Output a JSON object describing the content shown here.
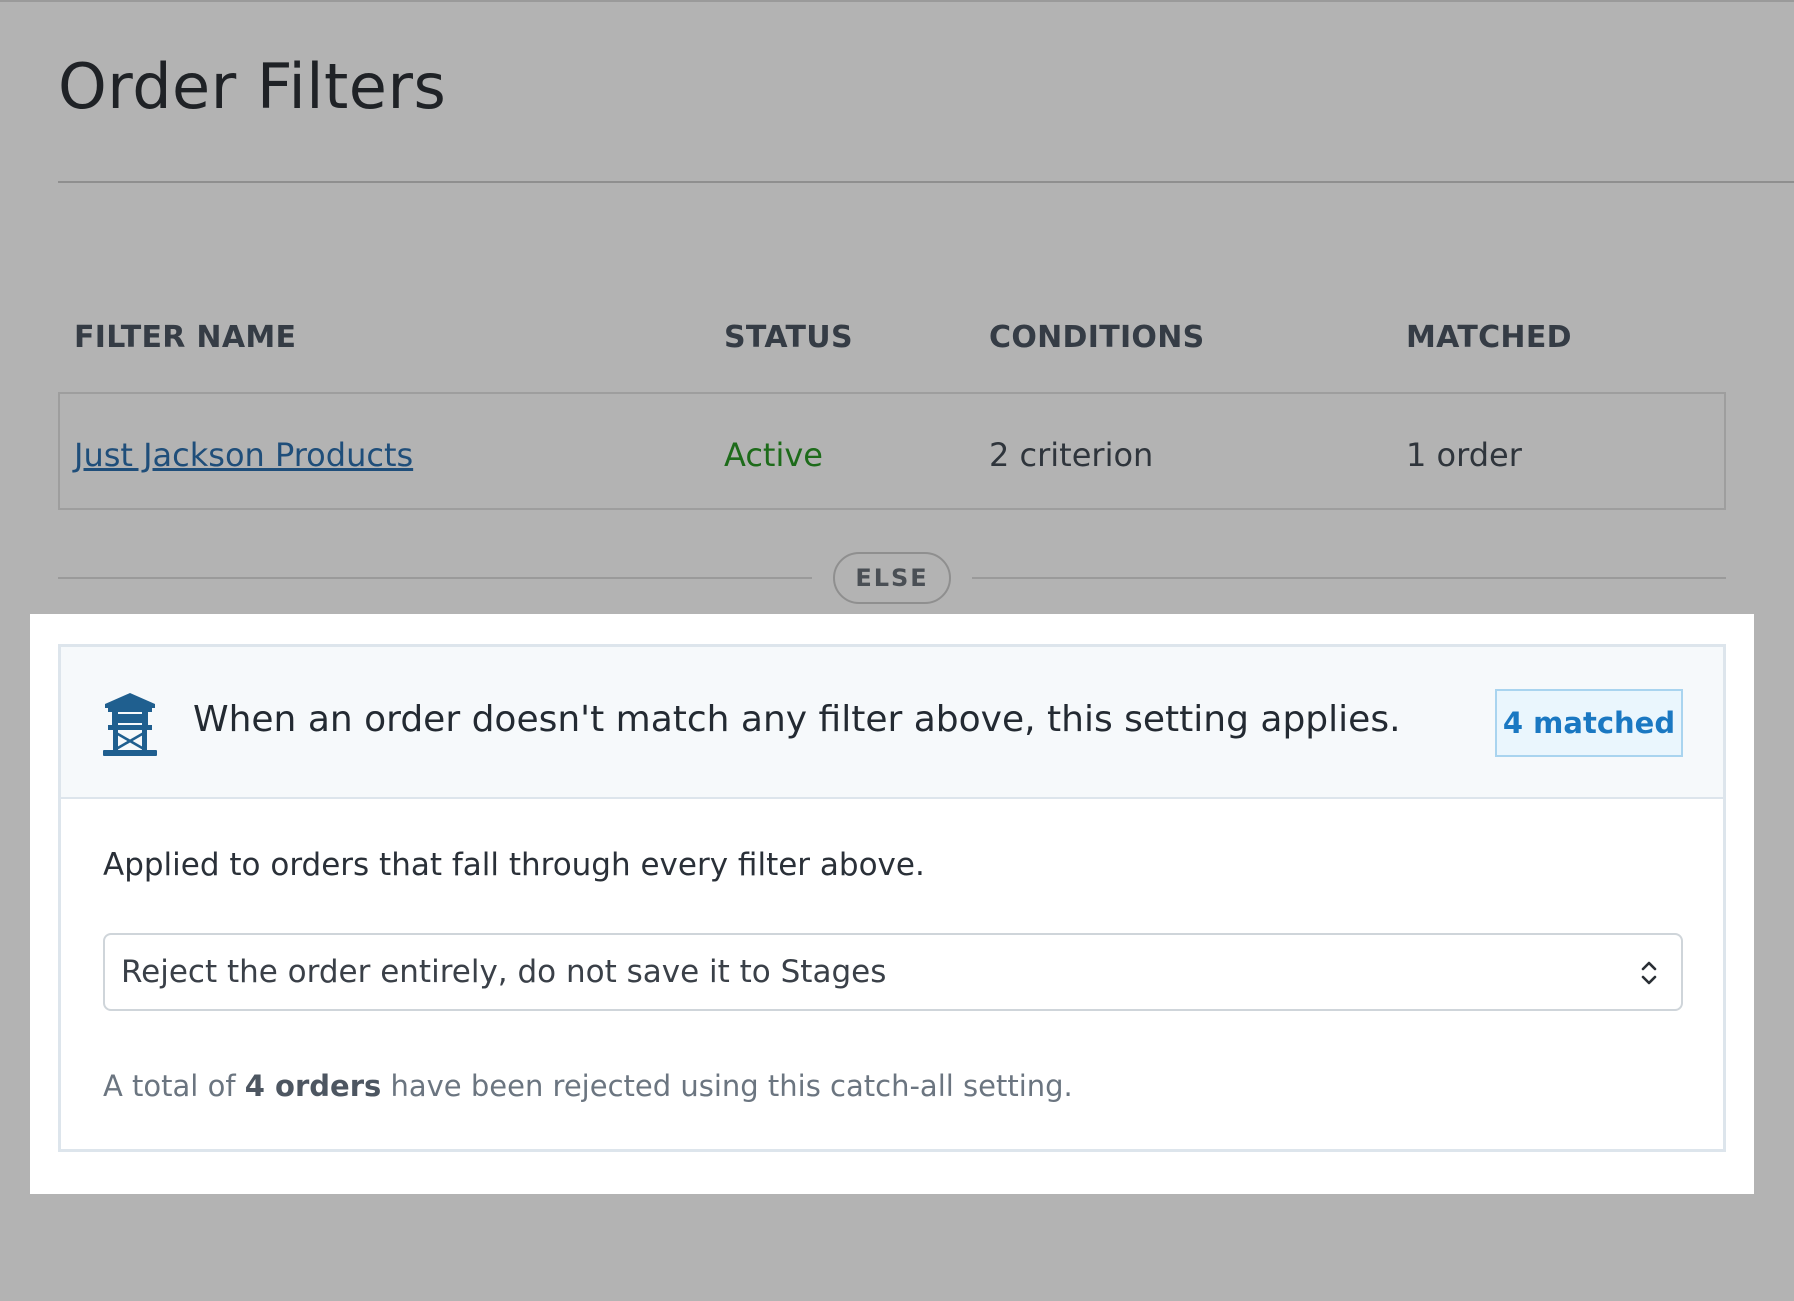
{
  "page": {
    "title": "Order Filters"
  },
  "table": {
    "headers": {
      "filter_name": "FILTER NAME",
      "status": "STATUS",
      "conditions": "CONDITIONS",
      "matched": "MATCHED"
    },
    "rows": [
      {
        "filter_name": "Just Jackson Products",
        "status": "Active",
        "conditions": "2 criterion",
        "matched": "1 order"
      }
    ]
  },
  "divider": {
    "label": "ELSE"
  },
  "catch_all": {
    "icon": "watchtower-icon",
    "title": "When an order doesn't match any filter above, this setting applies.",
    "badge": "4 matched",
    "description": "Applied to orders that fall through every filter above.",
    "select_value": "Reject the order entirely, do not save it to Stages",
    "footnote_prefix": "A total of ",
    "footnote_count": "4 orders",
    "footnote_suffix": " have been rejected using this catch-all setting."
  },
  "colors": {
    "link": "#1f4e7a",
    "status_active": "#1d6b1a",
    "icon": "#1f5f8f",
    "badge_text": "#1a78c2",
    "badge_bg": "#eaf6fd"
  }
}
